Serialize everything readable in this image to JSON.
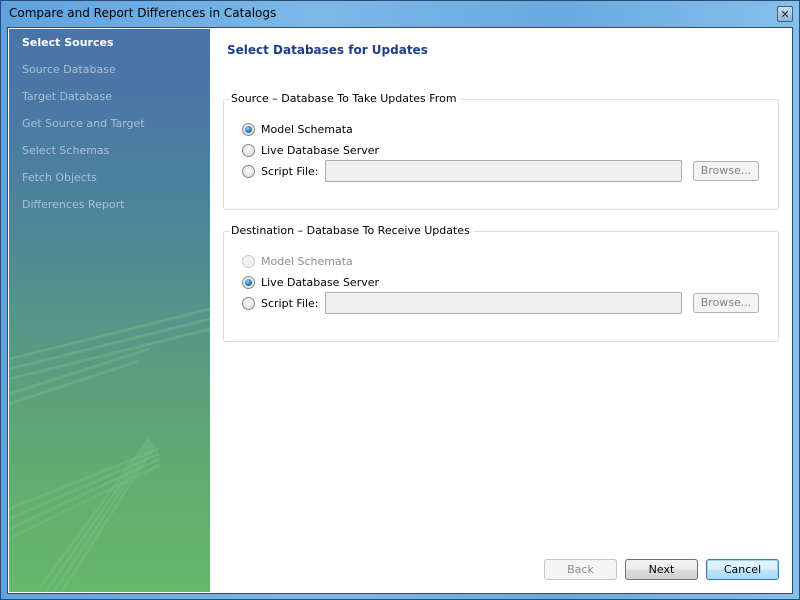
{
  "window": {
    "title": "Compare and Report Differences in Catalogs",
    "close_glyph": "✕"
  },
  "sidebar": {
    "items": [
      {
        "label": "Select Sources",
        "active": true
      },
      {
        "label": "Source Database",
        "active": false
      },
      {
        "label": "Target Database",
        "active": false
      },
      {
        "label": "Get Source and Target",
        "active": false
      },
      {
        "label": "Select Schemas",
        "active": false
      },
      {
        "label": "Fetch Objects",
        "active": false
      },
      {
        "label": "Differences Report",
        "active": false
      }
    ]
  },
  "main": {
    "title": "Select Databases for Updates",
    "source_group": {
      "legend": "Source – Database To Take Updates From",
      "options": [
        {
          "label": "Model Schemata",
          "checked": true,
          "disabled": false
        },
        {
          "label": "Live Database Server",
          "checked": false,
          "disabled": false
        },
        {
          "label": "Script File:",
          "checked": false,
          "disabled": false
        }
      ],
      "file_value": "",
      "browse_label": "Browse..."
    },
    "destination_group": {
      "legend": "Destination – Database To Receive Updates",
      "options": [
        {
          "label": "Model Schemata",
          "checked": false,
          "disabled": true
        },
        {
          "label": "Live Database Server",
          "checked": true,
          "disabled": false
        },
        {
          "label": "Script File:",
          "checked": false,
          "disabled": false
        }
      ],
      "file_value": "",
      "browse_label": "Browse..."
    }
  },
  "footer": {
    "back_label": "Back",
    "next_label": "Next",
    "cancel_label": "Cancel"
  }
}
